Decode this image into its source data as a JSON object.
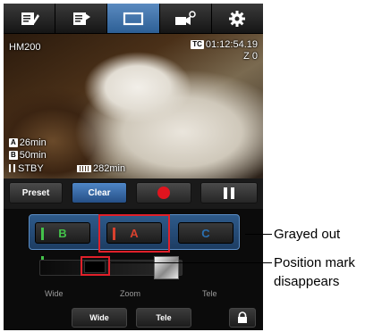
{
  "tabs": [
    {
      "name": "edit-icon",
      "active": false
    },
    {
      "name": "playlist-icon",
      "active": false
    },
    {
      "name": "screen-icon",
      "active": true
    },
    {
      "name": "camera-settings-icon",
      "active": false
    },
    {
      "name": "gear-icon",
      "active": false
    }
  ],
  "preview": {
    "model": "HM200",
    "tc_badge": "TC",
    "timecode": "01:12:54.19",
    "zoom_readout": "Z 0",
    "slot_a_badge": "A",
    "slot_a_time": "26min",
    "slot_b_badge": "B",
    "slot_b_time": "50min",
    "status": "STBY",
    "battery_time": "282min"
  },
  "controls": {
    "preset_label": "Preset",
    "clear_label": "Clear"
  },
  "presets": {
    "b_label": "B",
    "a_label": "A",
    "c_label": "C"
  },
  "zoom": {
    "wide_label": "Wide",
    "zoom_label": "Zoom",
    "tele_label": "Tele"
  },
  "bottom": {
    "wide_button": "Wide",
    "tele_button": "Tele"
  },
  "callouts": {
    "grayed_out": "Grayed out",
    "position_mark_line1": "Position mark",
    "position_mark_line2": "disappears"
  },
  "colors": {
    "highlight": "#e0202a",
    "preset_b": "#43c24a",
    "preset_a": "#d9412e",
    "preset_c": "#2a6fb0",
    "record": "#e0141e",
    "accent": "#3f74b3"
  }
}
